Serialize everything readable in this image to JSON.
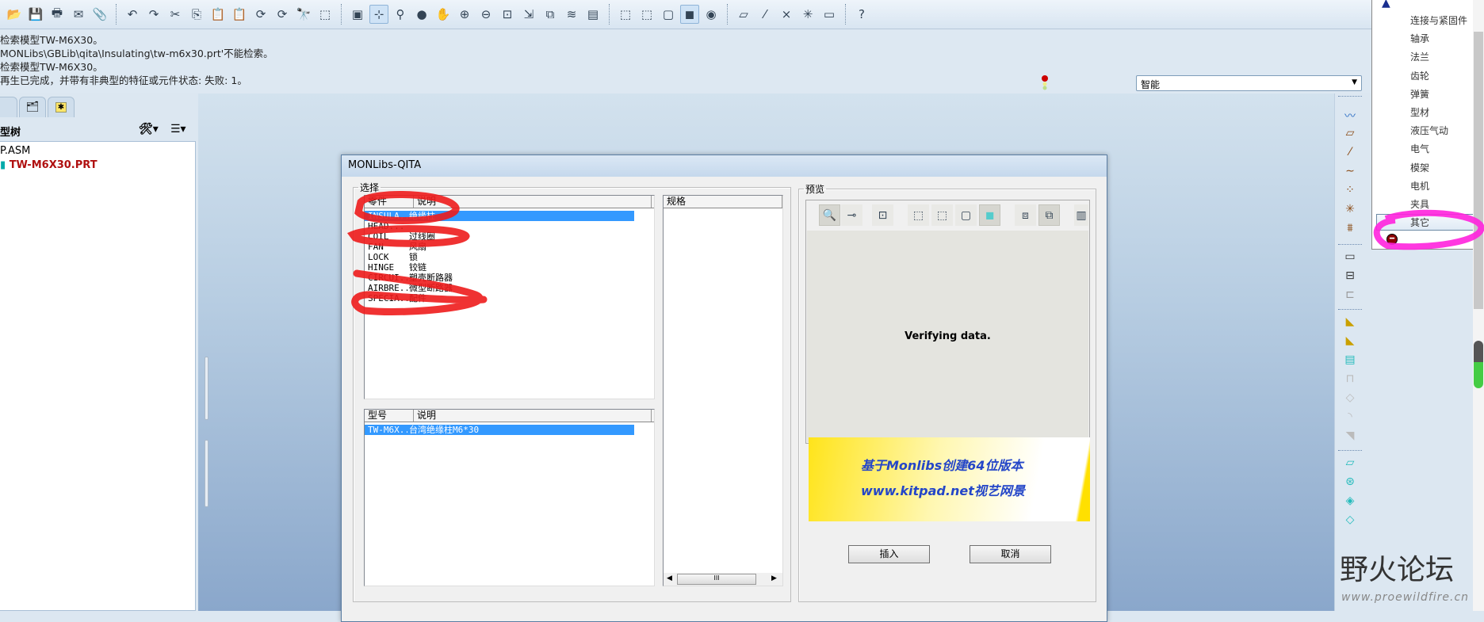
{
  "toolbar": {
    "icons": [
      "open-icon",
      "save-icon",
      "print-icon",
      "send-icon",
      "attach-icon",
      "|",
      "undo-icon",
      "redo-icon",
      "cut-icon",
      "copy-icon",
      "paste-icon",
      "paste-special-icon",
      "regenerate-icon",
      "regenerate-manager-icon",
      "find-icon",
      "select-box-icon",
      "|",
      "repaint-icon",
      "spin-center-icon",
      "orient-icon",
      "shade-icon",
      "pan-icon",
      "zoom-in-icon",
      "zoom-out-icon",
      "refit-icon",
      "reorient-icon",
      "view-manager-icon",
      "layers-icon",
      "snapshot-icon",
      "|",
      "wireframe-icon",
      "hidden-line-icon",
      "no-hidden-icon",
      "shading-icon",
      "appearance-icon",
      "|",
      "datum-planes-icon",
      "datum-axes-icon",
      "datum-points-icon",
      "csys-icon",
      "annotations-icon",
      "|",
      "context-help-icon"
    ],
    "glyphs": [
      "📂",
      "💾",
      "🖶",
      "✉",
      "📎",
      "",
      "↶",
      "↷",
      "✂",
      "⎘",
      "📋",
      "📋",
      "⟳",
      "⟳",
      "🔭",
      "⬚",
      "",
      "▣",
      "⊹",
      "⚲",
      "●",
      "✋",
      "⊕",
      "⊖",
      "⊡",
      "⇲",
      "⧉",
      "≋",
      "▤",
      "",
      "⬚",
      "⬚",
      "▢",
      "◼",
      "◉",
      "",
      "▱",
      "⁄",
      "×",
      "✳",
      "▭",
      "",
      "?"
    ],
    "active": [
      18,
      33
    ]
  },
  "messages": [
    "检索模型TW-M6X30。",
    "MONLibs\\GBLib\\qita\\Insulating\\tw-m6x30.prt'不能检索。",
    "检索模型TW-M6X30。",
    "再生已完成，并带有非典型的特征或元件状态: 失败: 1。"
  ],
  "filter": {
    "value": "智能"
  },
  "model_tree": {
    "title": "型树",
    "items": [
      "P.ASM",
      "TW-M6X30.PRT"
    ]
  },
  "dialog": {
    "title": "MONLibs-QITA",
    "select_group": "选择",
    "parts_list": {
      "headers": [
        "零件",
        "说明"
      ],
      "rows": [
        [
          "INSULA...",
          "绝缘柱"
        ],
        [
          "HEAD...",
          ""
        ],
        [
          "COIL",
          "过线圈"
        ],
        [
          "FAN",
          "风扇"
        ],
        [
          "LOCK",
          "锁"
        ],
        [
          "HINGE",
          "铰链"
        ],
        [
          "CIRCUI...",
          "塑壳断路器"
        ],
        [
          "AIRBRE...",
          "微型断路器"
        ],
        [
          "SPECIA...",
          "配件"
        ]
      ],
      "selected": 0
    },
    "model_list": {
      "headers": [
        "型号",
        "说明"
      ],
      "rows": [
        [
          "TW-M6X...",
          "台湾绝缘柱M6*30"
        ]
      ],
      "selected": 0
    },
    "spec_list": {
      "header": "规格",
      "scroll_thumb": "III"
    },
    "preview_group": "预览",
    "preview_status": "Verifying data.",
    "banner": {
      "line1": "基于Monlibs创建64位版本",
      "line2": "www.kitpad.net视艺网景"
    },
    "insert_button": "插入",
    "cancel_button": "取消"
  },
  "category_menu": {
    "items": [
      "连接与紧固件",
      "轴承",
      "法兰",
      "齿轮",
      "弹簧",
      "型材",
      "液压气动",
      "电气",
      "模架",
      "电机",
      "夹具",
      "其它"
    ],
    "highlighted": 11
  },
  "watermark": {
    "title": "野火论坛",
    "url": "www.proewildfire.cn"
  },
  "colors": {
    "selection": "#3399ff",
    "annotation_red": "#ee1c1c",
    "annotation_magenta": "#ff22dd"
  }
}
